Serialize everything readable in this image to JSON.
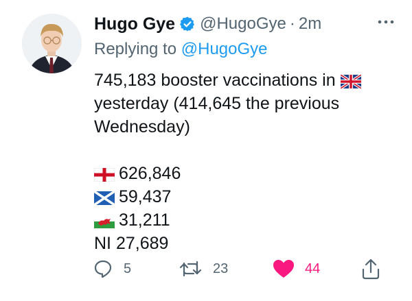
{
  "tweet": {
    "author_name": "Hugo Gye",
    "handle": "@HugoGye",
    "separator": "·",
    "time": "2m",
    "replying_prefix": "Replying to",
    "replying_handle": "@HugoGye",
    "text_line1": "745,183 booster vaccinations in",
    "text_line2": "yesterday (414,645 the previous",
    "text_line3": "Wednesday)",
    "england_count": "626,846",
    "scotland_count": "59,437",
    "wales_count": "31,211",
    "ni_line": "NI 27,689"
  },
  "actions": {
    "reply_count": "5",
    "retweet_count": "23",
    "like_count": "44"
  },
  "icons": {
    "verified": "verified-badge-icon",
    "more": "more-dots-icon",
    "reply": "reply-bubble-icon",
    "retweet": "retweet-icon",
    "like": "heart-icon",
    "share": "share-icon"
  },
  "colors": {
    "accent": "#1d9bf0",
    "like": "#f91880",
    "muted": "#536471",
    "text": "#0f1419"
  }
}
